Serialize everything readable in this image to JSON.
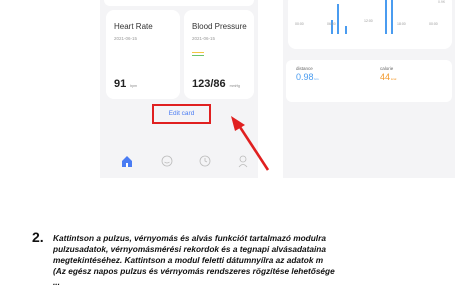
{
  "left_phone": {
    "heart_rate": {
      "title": "Heart Rate",
      "date": "2021-06-15",
      "value": "91",
      "unit": "bpm"
    },
    "blood_pressure": {
      "title": "Blood Pressure",
      "date": "2021-06-15",
      "value": "123/86",
      "unit": "mmHg"
    },
    "edit_card": "Edit card",
    "tabs": [
      "home-icon",
      "smile-icon",
      "clock-icon",
      "profile-icon"
    ]
  },
  "right_phone": {
    "stub_label": "0.9K",
    "time_ticks": [
      "00:00",
      "06:00",
      "12:00",
      "18:00",
      "00:00"
    ],
    "distance": {
      "label": "distance",
      "value": "0.98",
      "unit": "km"
    },
    "calorie": {
      "label": "calorie",
      "value": "44",
      "unit": "kcal"
    }
  },
  "instructions": {
    "number": "2.",
    "lines": [
      "Kattintson a pulzus, vérnyomás és alvás funkciót tartalmazó modulra",
      "pulzusadatok, vérnyomásmérési rekordok és a tegnapi alvásadataina",
      "megtekintéséhez. Kattintson a modul feletti dátumnyílra az adatok m",
      "(Az egész napos pulzus és vérnyomás rendszeres rögzítése lehetősége",
      "... "
    ]
  },
  "colors": {
    "accent_blue": "#4a7cf3",
    "highlight_red": "#e02020",
    "orange": "#f39a2c"
  }
}
